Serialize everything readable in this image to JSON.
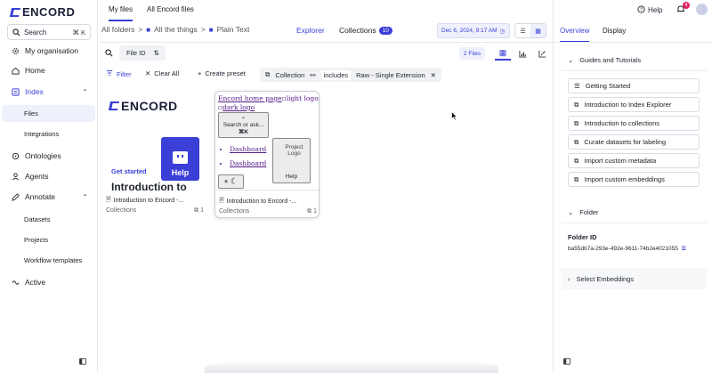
{
  "app": {
    "brand": "ENCORD"
  },
  "sidebar": {
    "search_label": "Search",
    "search_shortcut": "⌘ K",
    "items": [
      {
        "label": "My organisation"
      },
      {
        "label": "Home"
      },
      {
        "label": "Index"
      },
      {
        "label": "Files"
      },
      {
        "label": "Integrations"
      },
      {
        "label": "Ontologies"
      },
      {
        "label": "Agents"
      },
      {
        "label": "Annotate"
      },
      {
        "label": "Datasets"
      },
      {
        "label": "Projects"
      },
      {
        "label": "Workflow templates"
      },
      {
        "label": "Active"
      }
    ]
  },
  "header": {
    "tabs": [
      {
        "label": "My files"
      },
      {
        "label": "All Encord files"
      }
    ],
    "help_label": "Help",
    "notification_count": "4"
  },
  "breadcrumb": {
    "root": "All folders",
    "folder1": "All the things",
    "folder2": "Plain Text"
  },
  "view_tabs": {
    "explorer": "Explorer",
    "collections": "Collections",
    "collections_count": "10"
  },
  "datebox": {
    "value": "Dec 6, 2024, 9:17 AM"
  },
  "toolbar": {
    "sort_field": "File ID",
    "file_count": "2 Files"
  },
  "filters": {
    "filter_label": "Filter",
    "clear_label": "Clear All",
    "preset_label": "Create preset",
    "condition_field": "Collection",
    "condition_op": "includes",
    "condition_value": "Raw - Single Extension"
  },
  "cards": [
    {
      "promo_tag": "Get started",
      "promo_title": "Introduction to",
      "help_label": "Help",
      "name": "Introduction to Encord -...",
      "meta_label": "Collections",
      "meta_count": "1"
    },
    {
      "link_home": "Encord home page",
      "alt_light": "light logo",
      "alt_dark": "dark logo",
      "search_btn": "Search or ask...",
      "search_kbd": "⌘K",
      "links": [
        "Dashboard",
        "Dashboard"
      ],
      "project_logo_alt": "Project Logo",
      "help_label": "Help",
      "name": "Introduction to Encord -...",
      "meta_label": "Collections",
      "meta_count": "1"
    }
  ],
  "right_panel": {
    "tabs": [
      {
        "label": "Overview"
      },
      {
        "label": "Display"
      }
    ],
    "guides_title": "Guides and Tutorials",
    "guides": [
      {
        "label": "Getting Started",
        "icon": "list-icon"
      },
      {
        "label": "Introduction to Index Explorer",
        "icon": "external-link-icon"
      },
      {
        "label": "Introduction to collections",
        "icon": "external-link-icon"
      },
      {
        "label": "Curate datasets for labeling",
        "icon": "external-link-icon"
      },
      {
        "label": "Import custom metadata",
        "icon": "external-link-icon"
      },
      {
        "label": "Import custom embeddings",
        "icon": "external-link-icon"
      }
    ],
    "folder_title": "Folder",
    "folder_id_label": "Folder ID",
    "folder_id_value": "ba55db7a-293e-492e-9611-74b2e4021055",
    "embeddings_title": "Select Embeddings"
  },
  "colors": {
    "accent": "#3a3fd6",
    "badge_red": "#e0245e"
  }
}
